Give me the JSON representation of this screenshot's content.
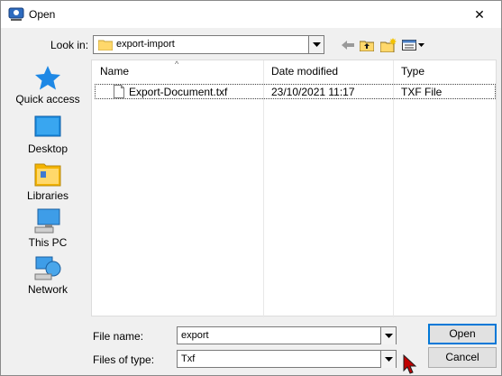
{
  "window": {
    "title": "Open",
    "close_symbol": "✕"
  },
  "toolbar": {
    "lookin_label": "Look in:",
    "lookin_value": "export-import",
    "back_icon": "back-arrow-icon",
    "up_icon": "up-folder-icon",
    "new_folder_icon": "new-folder-icon",
    "view_icon": "view-menu-icon"
  },
  "places": [
    {
      "label": "Quick access",
      "icon": "quick-access-star-icon"
    },
    {
      "label": "Desktop",
      "icon": "desktop-icon"
    },
    {
      "label": "Libraries",
      "icon": "libraries-icon"
    },
    {
      "label": "This PC",
      "icon": "this-pc-icon"
    },
    {
      "label": "Network",
      "icon": "network-icon"
    }
  ],
  "filelist": {
    "columns": [
      "Name",
      "Date modified",
      "Type"
    ],
    "rows": [
      {
        "name": "Export-Document.txf",
        "date": "23/10/2021 11:17",
        "type": "TXF File"
      }
    ]
  },
  "form": {
    "filename_label": "File name:",
    "filename_value": "export",
    "filetype_label": "Files of type:",
    "filetype_value": "Txf",
    "open_label": "Open",
    "cancel_label": "Cancel"
  },
  "colors": {
    "accent": "#0078d7",
    "star": "#1e88e5",
    "folder": "#ffd86b"
  }
}
